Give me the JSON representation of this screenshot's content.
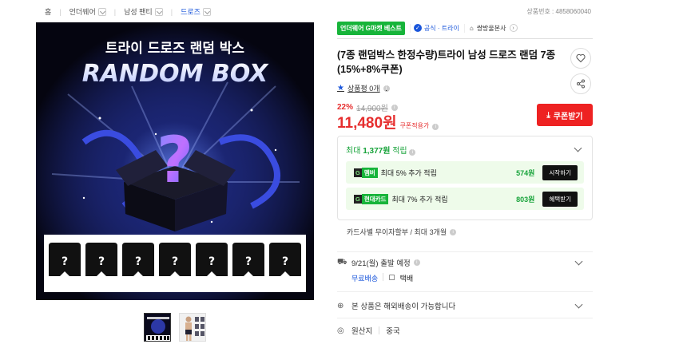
{
  "breadcrumb": {
    "items": [
      "홈",
      "언더웨어",
      "남성 팬티",
      "드로즈"
    ]
  },
  "product_no_label": "상품번호 : 4858060040",
  "image": {
    "headline_kr": "트라이 드로즈 랜덤 박스",
    "headline_en": "RANDOM BOX",
    "question_mark": "?"
  },
  "tags": {
    "best": "언더웨어 G마켓 베스트",
    "official": "공식 · 트라이",
    "store": "쌍방울본사"
  },
  "title": "(7종 랜덤박스 한정수량)트라이 남성 드로즈 랜덤 7종 (15%+8%쿠폰)",
  "review": {
    "label": "상품평 0개"
  },
  "price": {
    "discount_rate": "22%",
    "original": "14,900원",
    "sale": "11,480원",
    "coupon_note": "쿠폰적용가",
    "coupon_button": "쿠폰받기"
  },
  "points": {
    "header_prefix": "최대",
    "header_amount": "1,377원",
    "header_suffix": "적립",
    "rows": [
      {
        "tag_prefix": "G",
        "tag_label": "멤버",
        "text": "최대 5% 추가 적립",
        "value": "574원",
        "button": "시작하기"
      },
      {
        "tag_prefix": "G",
        "tag_label": "현대카드",
        "text": "최대 7% 추가 적립",
        "value": "803원",
        "button": "혜택받기"
      }
    ]
  },
  "installment": "카드사별 무이자할부 / 최대 3개월",
  "shipping": {
    "date": "9/21(월) 출발 예정",
    "free": "무료배송",
    "method": "택배"
  },
  "overseas": "본 상품은 해외배송이 가능합니다",
  "origin": {
    "label": "원산지",
    "value": "중국"
  },
  "colors": {
    "accent_red": "#e22222",
    "green": "#17b43a",
    "blue": "#1a56db"
  }
}
